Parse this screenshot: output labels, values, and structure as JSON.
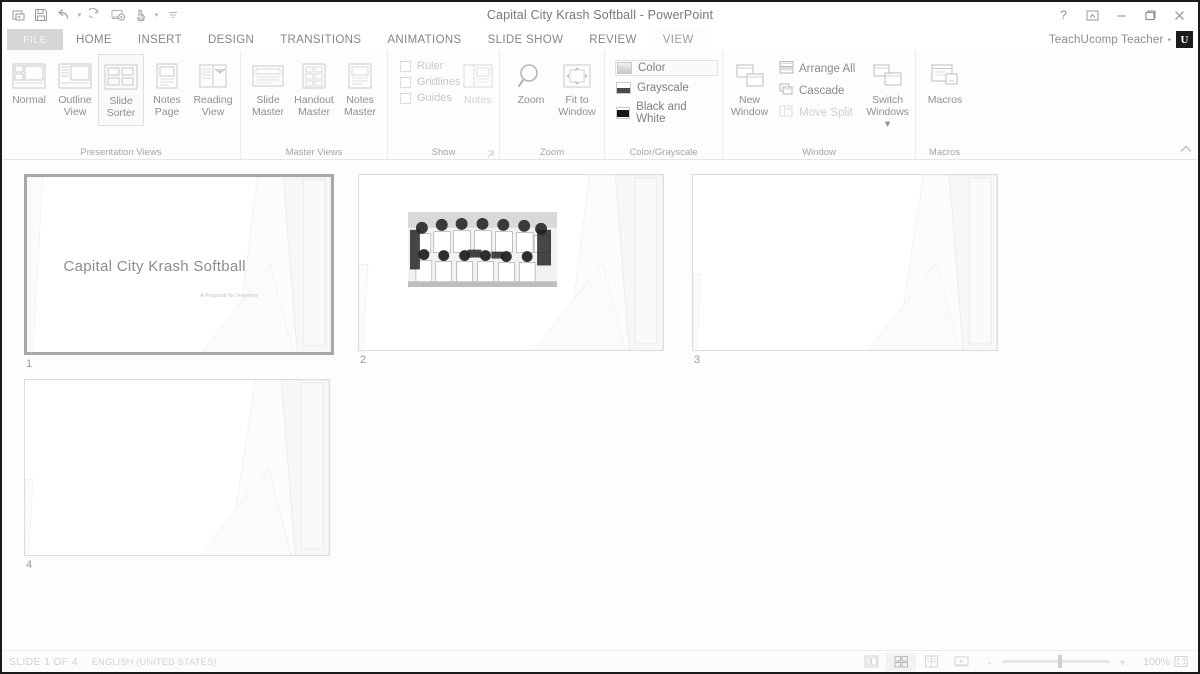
{
  "window": {
    "title": "Capital City Krash Softball - PowerPoint",
    "help_icon": "question-mark-icon",
    "ribbon_display_icon": "ribbon-display-options-icon",
    "minimize_icon": "minimize-icon",
    "restore_icon": "restore-icon",
    "close_icon": "close-icon"
  },
  "quick_access": [
    {
      "name": "autosave-sync-icon",
      "label": ""
    },
    {
      "name": "save-icon",
      "label": ""
    },
    {
      "name": "undo-icon",
      "label": ""
    },
    {
      "name": "redo-icon",
      "label": ""
    },
    {
      "name": "start-from-beginning-icon",
      "label": ""
    },
    {
      "name": "touch-mode-icon",
      "label": ""
    },
    {
      "name": "customize-quick-access-toolbar-icon",
      "label": ""
    }
  ],
  "account": {
    "name": "TeachUcomp Teacher",
    "logo_letter": "U"
  },
  "tabs": [
    {
      "label": "FILE",
      "active": false
    },
    {
      "label": "HOME",
      "active": false
    },
    {
      "label": "INSERT",
      "active": false
    },
    {
      "label": "DESIGN",
      "active": false
    },
    {
      "label": "TRANSITIONS",
      "active": false
    },
    {
      "label": "ANIMATIONS",
      "active": false
    },
    {
      "label": "SLIDE SHOW",
      "active": false
    },
    {
      "label": "REVIEW",
      "active": false
    },
    {
      "label": "VIEW",
      "active": true
    }
  ],
  "ribbon": {
    "collapse_icon": "collapse-ribbon-icon",
    "groups": [
      {
        "label": "Presentation Views",
        "buttons": [
          {
            "label_top": "Normal",
            "label_bottom": "",
            "selected": false,
            "icon": "normal-view-icon"
          },
          {
            "label_top": "Outline",
            "label_bottom": "View",
            "selected": false,
            "icon": "outline-view-icon"
          },
          {
            "label_top": "Slide",
            "label_bottom": "Sorter",
            "selected": true,
            "icon": "slide-sorter-icon"
          },
          {
            "label_top": "Notes",
            "label_bottom": "Page",
            "selected": false,
            "icon": "notes-page-icon"
          },
          {
            "label_top": "Reading",
            "label_bottom": "View",
            "selected": false,
            "icon": "reading-view-icon"
          }
        ]
      },
      {
        "label": "Master Views",
        "buttons": [
          {
            "label_top": "Slide",
            "label_bottom": "Master",
            "selected": false,
            "icon": "slide-master-icon"
          },
          {
            "label_top": "Handout",
            "label_bottom": "Master",
            "selected": false,
            "icon": "handout-master-icon"
          },
          {
            "label_top": "Notes",
            "label_bottom": "Master",
            "selected": false,
            "icon": "notes-master-icon"
          }
        ]
      },
      {
        "label": "Show",
        "has_dialog_launcher": true,
        "checkboxes": [
          {
            "label": "Ruler",
            "checked": false
          },
          {
            "label": "Gridlines",
            "checked": false
          },
          {
            "label": "Guides",
            "checked": false
          }
        ],
        "buttons": [
          {
            "label_top": "Notes",
            "label_bottom": "",
            "selected": false,
            "disabled": true,
            "icon": "notes-icon"
          }
        ]
      },
      {
        "label": "Zoom",
        "buttons": [
          {
            "label_top": "Zoom",
            "label_bottom": "",
            "selected": false,
            "icon": "zoom-magnifier-icon"
          },
          {
            "label_top": "Fit to",
            "label_bottom": "Window",
            "selected": false,
            "icon": "fit-to-window-icon"
          }
        ]
      },
      {
        "label": "Color/Grayscale",
        "options": [
          {
            "label": "Color",
            "selected": true,
            "icon": "color-swatch-icon"
          },
          {
            "label": "Grayscale",
            "selected": false,
            "icon": "grayscale-swatch-icon"
          },
          {
            "label": "Black and White",
            "selected": false,
            "icon": "black-and-white-swatch-icon"
          }
        ]
      },
      {
        "label": "Window",
        "buttons": [
          {
            "label_top": "New",
            "label_bottom": "Window",
            "selected": false,
            "icon": "new-window-icon"
          },
          {
            "label_top": "Switch",
            "label_bottom": "Windows",
            "selected": false,
            "has_caret": true,
            "icon": "switch-windows-icon"
          }
        ],
        "small_buttons": [
          {
            "label": "Arrange All",
            "disabled": false,
            "icon": "arrange-all-icon"
          },
          {
            "label": "Cascade",
            "disabled": false,
            "icon": "cascade-icon"
          },
          {
            "label": "Move Split",
            "disabled": true,
            "icon": "move-split-icon"
          }
        ]
      },
      {
        "label": "Macros",
        "buttons": [
          {
            "label_top": "Macros",
            "label_bottom": "",
            "selected": false,
            "icon": "macros-icon"
          }
        ]
      }
    ]
  },
  "slides": [
    {
      "number": "1",
      "selected": true,
      "title": "Capital City Krash Softball",
      "subtitle": "A Proposal for Investors",
      "has_photo": false
    },
    {
      "number": "2",
      "selected": false,
      "title": "",
      "subtitle": "",
      "has_photo": true
    },
    {
      "number": "3",
      "selected": false,
      "title": "",
      "subtitle": "",
      "has_photo": false
    },
    {
      "number": "4",
      "selected": false,
      "title": "",
      "subtitle": "",
      "has_photo": false
    }
  ],
  "statusbar": {
    "slide_indicator": "SLIDE 1 OF 4",
    "language": "ENGLISH (UNITED STATES)",
    "zoom_percent": "100%",
    "view_buttons": [
      {
        "name": "normal-view-button",
        "active": false
      },
      {
        "name": "slide-sorter-view-button",
        "active": true
      },
      {
        "name": "reading-view-button",
        "active": false
      },
      {
        "name": "slide-show-button",
        "active": false
      }
    ],
    "zoom_out_label": "-",
    "zoom_in_label": "+",
    "fit_slide_icon": "fit-slide-to-window-icon"
  },
  "colors": {
    "accent": "#a8a8a8",
    "text": "#8b8b8b",
    "muted": "#cfcfcf",
    "background": "#fdfdfd"
  }
}
